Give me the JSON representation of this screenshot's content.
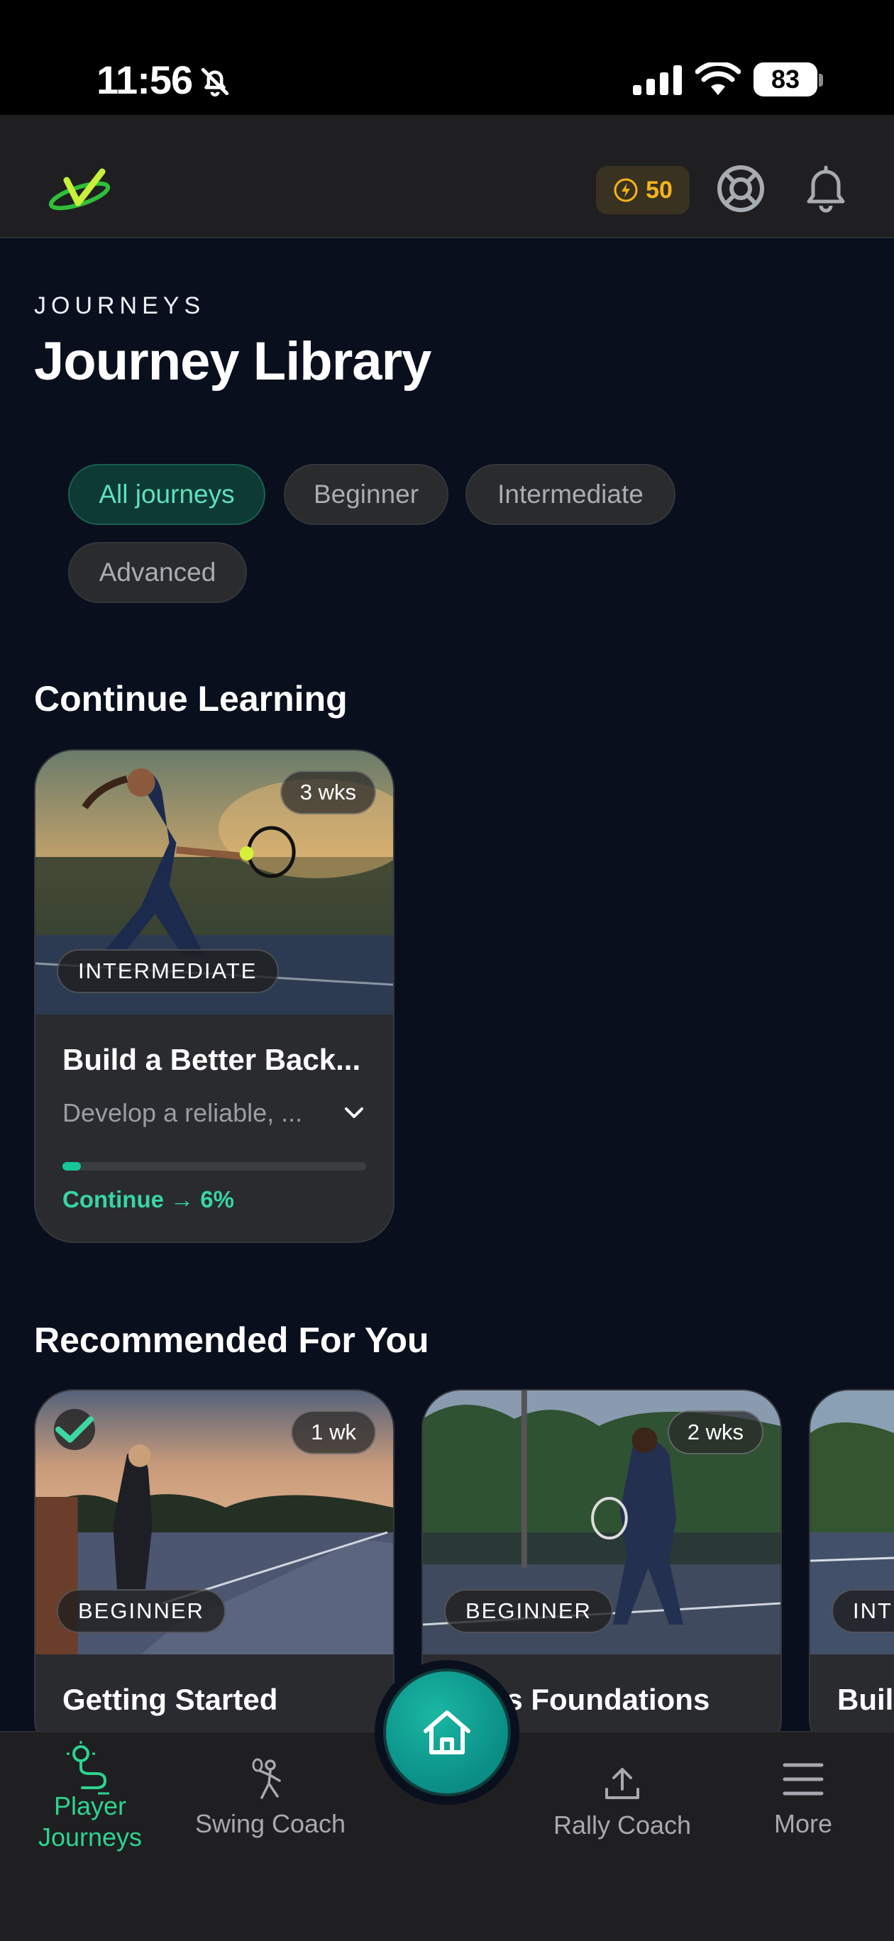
{
  "status_bar": {
    "time": "11:56",
    "battery": "83"
  },
  "header": {
    "coins": "50"
  },
  "page": {
    "eyebrow": "JOURNEYS",
    "title": "Journey Library"
  },
  "filters": [
    "All journeys",
    "Beginner",
    "Intermediate",
    "Advanced"
  ],
  "sections": {
    "continue": "Continue Learning",
    "recommended": "Recommended For You"
  },
  "continue_card": {
    "duration": "3 wks",
    "level": "INTERMEDIATE",
    "title": "Build a Better Back...",
    "description": "Develop a reliable, ...",
    "progress": 0.06,
    "cta": "Continue → 6%"
  },
  "recommended_cards": [
    {
      "duration": "1 wk",
      "level": "BEGINNER",
      "title": "Getting Started",
      "completed": true
    },
    {
      "duration": "2 wks",
      "level": "BEGINNER",
      "title": "nis Foundations"
    },
    {
      "level": "INTE",
      "title": "Buil"
    }
  ],
  "nav": {
    "player_journeys": "Player\nJourneys",
    "swing_coach": "Swing Coach",
    "rally_coach": "Rally Coach",
    "more": "More"
  },
  "colors": {
    "accent": "#2dd48f",
    "coin": "#f3b51a",
    "background": "#0a0f1d"
  }
}
